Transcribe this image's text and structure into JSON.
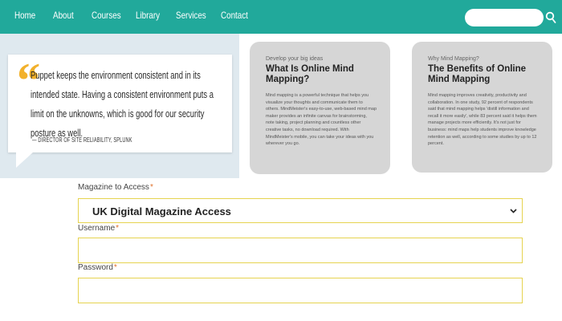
{
  "nav": {
    "items": [
      {
        "label": "Home"
      },
      {
        "label": "About"
      },
      {
        "label": "Courses"
      },
      {
        "label": "Library"
      },
      {
        "label": "Services"
      },
      {
        "label": "Contact"
      }
    ],
    "search": {
      "placeholder": "",
      "icon": "search-icon"
    }
  },
  "quote": {
    "text": "Puppet keeps the environment consistent and in its intended state. Having a consistent environment puts a limit on the unknowns, which is good for our security posture as well.",
    "attribution": "— DIRECTOR OF SITE RELIABILITY, SPLUNK",
    "accent_color": "#f2b12b"
  },
  "cards": [
    {
      "eyebrow": "Develop your big ideas",
      "title": "What Is Online Mind Mapping?",
      "body": "Mind mapping is a powerful technique that helps you visualize your thoughts and communicate them to others. MindMeister's easy-to-use, web-based mind map maker provides an infinite canvas for brainstorming, note taking, project planning and countless other creative tasks, no download required. With MindMeister's mobile, you can take your ideas with you wherever you go."
    },
    {
      "eyebrow": "Why Mind Mapping?",
      "title": "The Benefits of Online Mind Mapping",
      "body": "Mind mapping improves creativity, productivity and collaboration. In one study, 92 percent of respondents said that mind mapping helps 'distill information and recall it more easily', while 83 percent said it helps them manage projects more efficiently. It's not just for business: mind maps help students improve knowledge retention as well, according to some studies by up to 12 percent."
    }
  ],
  "form": {
    "magazine": {
      "label": "Magazine to Access",
      "required": "*",
      "value": "UK Digital Magazine Access"
    },
    "username": {
      "label": "Username",
      "required": "*",
      "value": ""
    },
    "password": {
      "label": "Password",
      "required": "*",
      "value": ""
    }
  },
  "colors": {
    "nav_bg": "#21a99b",
    "quote_panel_bg": "#dfe9ef",
    "card_bg": "#d6d6d6",
    "field_border": "#e6d34f",
    "required": "#e0712b"
  }
}
